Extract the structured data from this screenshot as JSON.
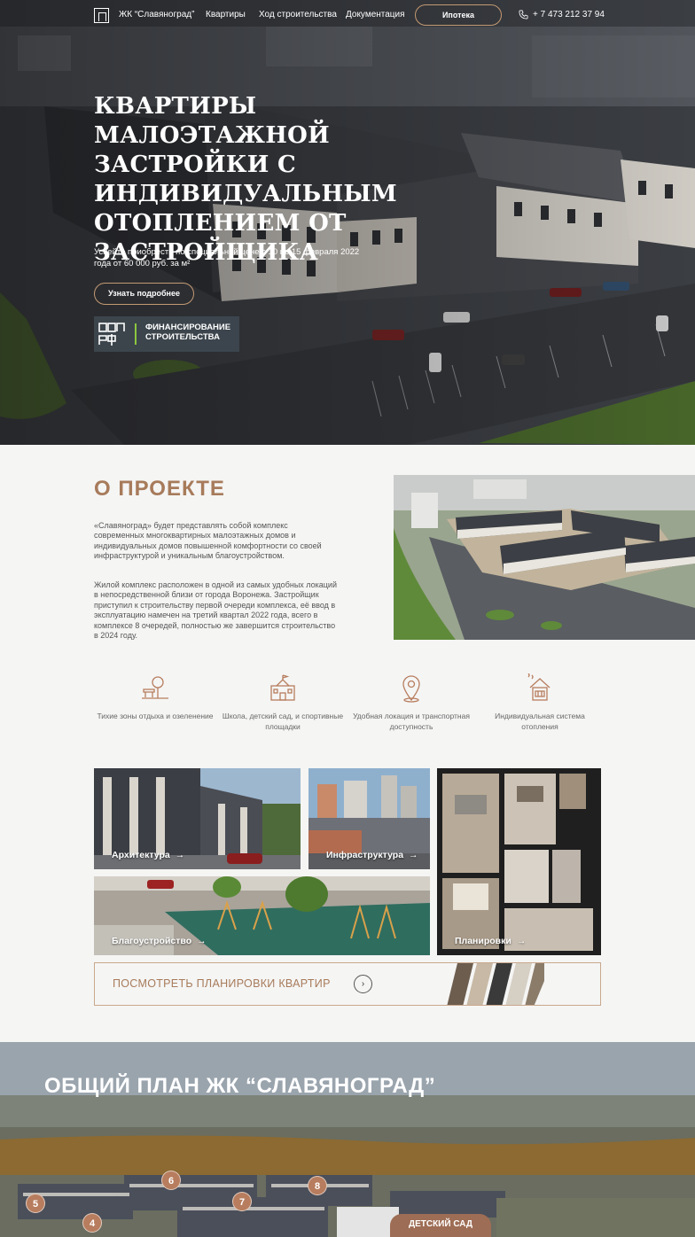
{
  "nav": {
    "brand": "ЖК “Славяноград”",
    "links": [
      "Квартиры",
      "Ход строительства",
      "Документация"
    ],
    "mortgage": "Ипотека",
    "phone": "+ 7 473 212 37 94"
  },
  "hero": {
    "title": "КВАРТИРЫ МАЛОЭТАЖНОЙ ЗАСТРОЙКИ С ИНДИВИДУАЛЬНЫМ ОТОПЛЕНИЕМ ОТ ЗАСТРОЙЩИКА",
    "subtitle": "Успейте приобрести по специальной цене с 10 по 15 февраля 2022 года от 60 000 руб. за м²",
    "cta": "Узнать подробнее",
    "badge_line1": "ФИНАНСИРОВАНИЕ",
    "badge_line2": "СТРОИТЕЛЬСТВА",
    "badge_logo": "ДОМ РФ"
  },
  "about": {
    "title": "О ПРОЕКТЕ",
    "p1": "«Славяноград» будет представлять собой комплекс современных многоквартирных малоэтажных домов и индивидуальных домов повышенной комфортности со своей инфраструктурой и уникальным благоустройством.",
    "p2": "Жилой комплекс расположен в одной из самых удобных локаций в непосредственной близи от города Воронежа. Застройщик приступил к строительству первой очереди комплекса, её ввод в эксплуатацию намечен на третий квартал 2022 года, всего в комплексе 8 очередей, полностью же завершится строительство в 2024 году."
  },
  "features": [
    {
      "label": "Тихие зоны отдыха и озеленение",
      "icon": "park-icon"
    },
    {
      "label": "Школа, детский сад, и спортивные площадки",
      "icon": "school-icon"
    },
    {
      "label": "Удобная локация и транспортная доступность",
      "icon": "location-icon"
    },
    {
      "label": "Индивидуальная система отопления",
      "icon": "heating-icon"
    }
  ],
  "tiles": {
    "architecture": "Архитектура",
    "infrastructure": "Инфраструктура",
    "landscaping": "Благоустройство",
    "layouts": "Планировки",
    "arrow": "→"
  },
  "plans_bar": {
    "text": "ПОСМОТРЕТЬ ПЛАНИРОВКИ КВАРТИР",
    "arrow": "›"
  },
  "general_plan": {
    "title": "ОБЩИЙ ПЛАН ЖК “СЛАВЯНОГРАД”",
    "markers": [
      "5",
      "4",
      "6",
      "7",
      "8"
    ],
    "kindergarten": "ДЕТСКИЙ САД"
  },
  "colors": {
    "accent": "#a77b5b",
    "border_accent": "#c49a73",
    "marker": "#b77d5e",
    "dom_green": "#8cc63f"
  }
}
